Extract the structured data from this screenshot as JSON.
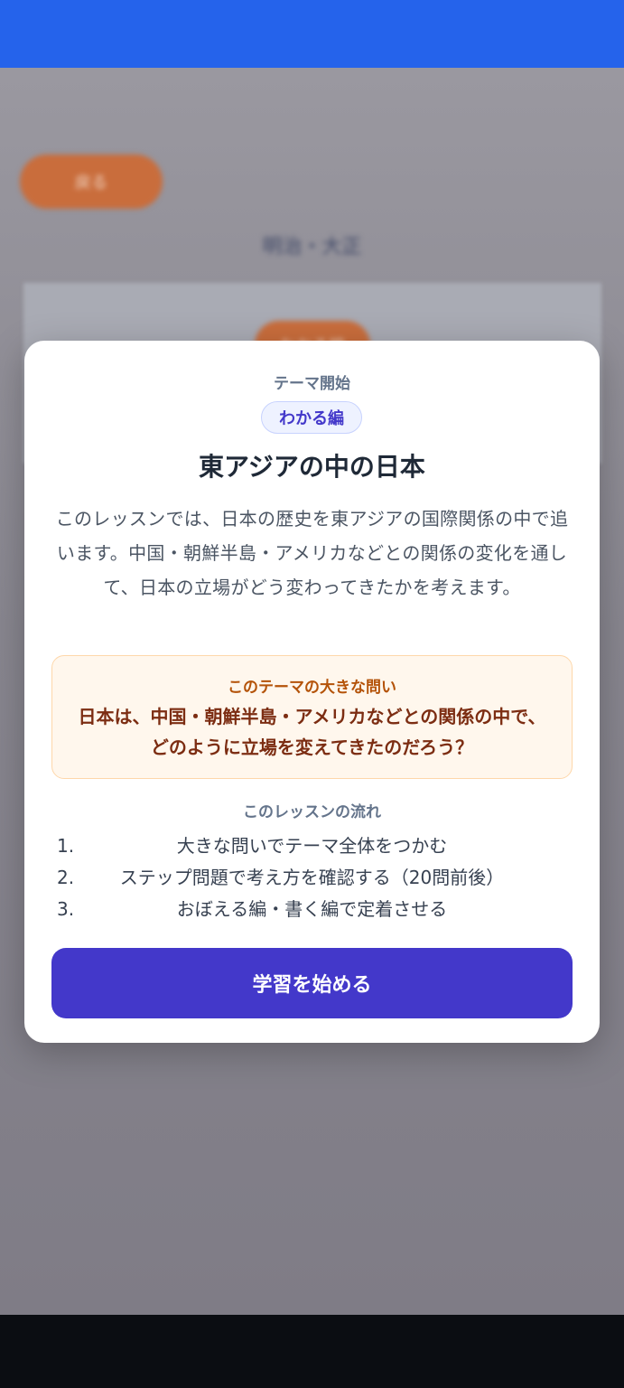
{
  "background": {
    "back_button_label": "戻る",
    "title": "明治・大正",
    "pill_label": "わかる編"
  },
  "modal": {
    "eyebrow": "テーマ開始",
    "level_badge": "わかる編",
    "title": "東アジアの中の日本",
    "description": "このレッスンでは、日本の歴史を東アジアの国際関係の中で追います。中国・朝鮮半島・アメリカなどとの関係の変化を通して、日本の立場がどう変わってきたかを考えます。",
    "big_question": {
      "label": "このテーマの大きな問い",
      "text": "日本は、中国・朝鮮半島・アメリカなどとの関係の中で、どのように立場を変えてきたのだろう？"
    },
    "flow": {
      "title": "このレッスンの流れ",
      "items": [
        {
          "num": "1.",
          "text": "大きな問いでテーマ全体をつかむ"
        },
        {
          "num": "2.",
          "text": "ステップ問題で考え方を確認する（20問前後）"
        },
        {
          "num": "3.",
          "text": "おぼえる編・書く編で定着させる"
        }
      ]
    },
    "start_button": "学習を始める"
  },
  "colors": {
    "top_bar": "#2563eb",
    "primary_button": "#4338ca",
    "question_bg": "#fff7ed",
    "question_text": "#7c2d12",
    "accent_orange": "#c96d3c"
  }
}
